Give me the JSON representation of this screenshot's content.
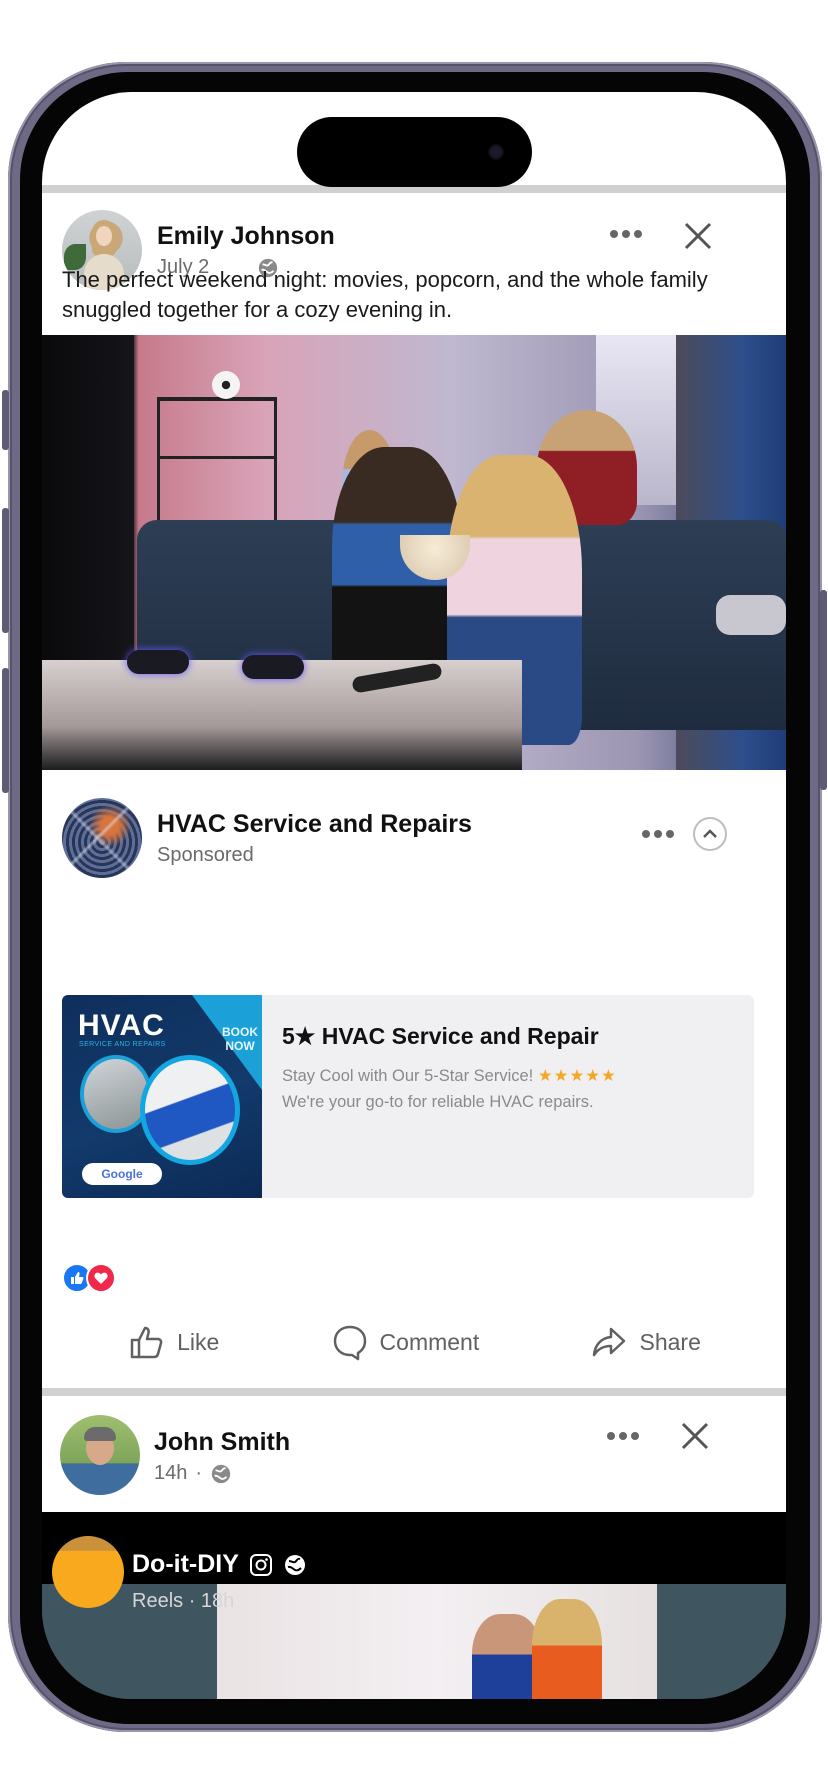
{
  "feed": {
    "posts": [
      {
        "author": "Emily Johnson",
        "date": "July 2",
        "privacy_icon": "globe-icon",
        "text": "The perfect weekend night: movies, popcorn, and the whole family snuggled together for a cozy evening in.",
        "image_alt": "Family watching a movie on a sofa with popcorn"
      }
    ],
    "sponsored": {
      "advertiser": "HVAC Service and Repairs",
      "label": "Sponsored",
      "ad": {
        "image_heading": "HVAC",
        "image_subheading": "SERVICE AND REPAIRS",
        "image_cta_line1": "BOOK",
        "image_cta_line2": "NOW",
        "image_badge": "Google",
        "title": "5★ HVAC Service and Repair",
        "description_line1": "Stay Cool with Our 5-Star Service!",
        "stars": "★★★★★",
        "description_line2": "We're your go-to for reliable HVAC repairs."
      }
    },
    "reactions": [
      "like",
      "love"
    ],
    "actions": {
      "like": "Like",
      "comment": "Comment",
      "share": "Share"
    },
    "next_post": {
      "author": "John Smith",
      "time": "14h",
      "separator": "·"
    },
    "reel": {
      "author": "Do-it-DIY",
      "meta": "Reels · 18h"
    }
  },
  "colors": {
    "like_blue": "#1877f2",
    "love_red": "#f0284a",
    "star_orange": "#f7a623",
    "divider_gray": "#ced0d2"
  }
}
